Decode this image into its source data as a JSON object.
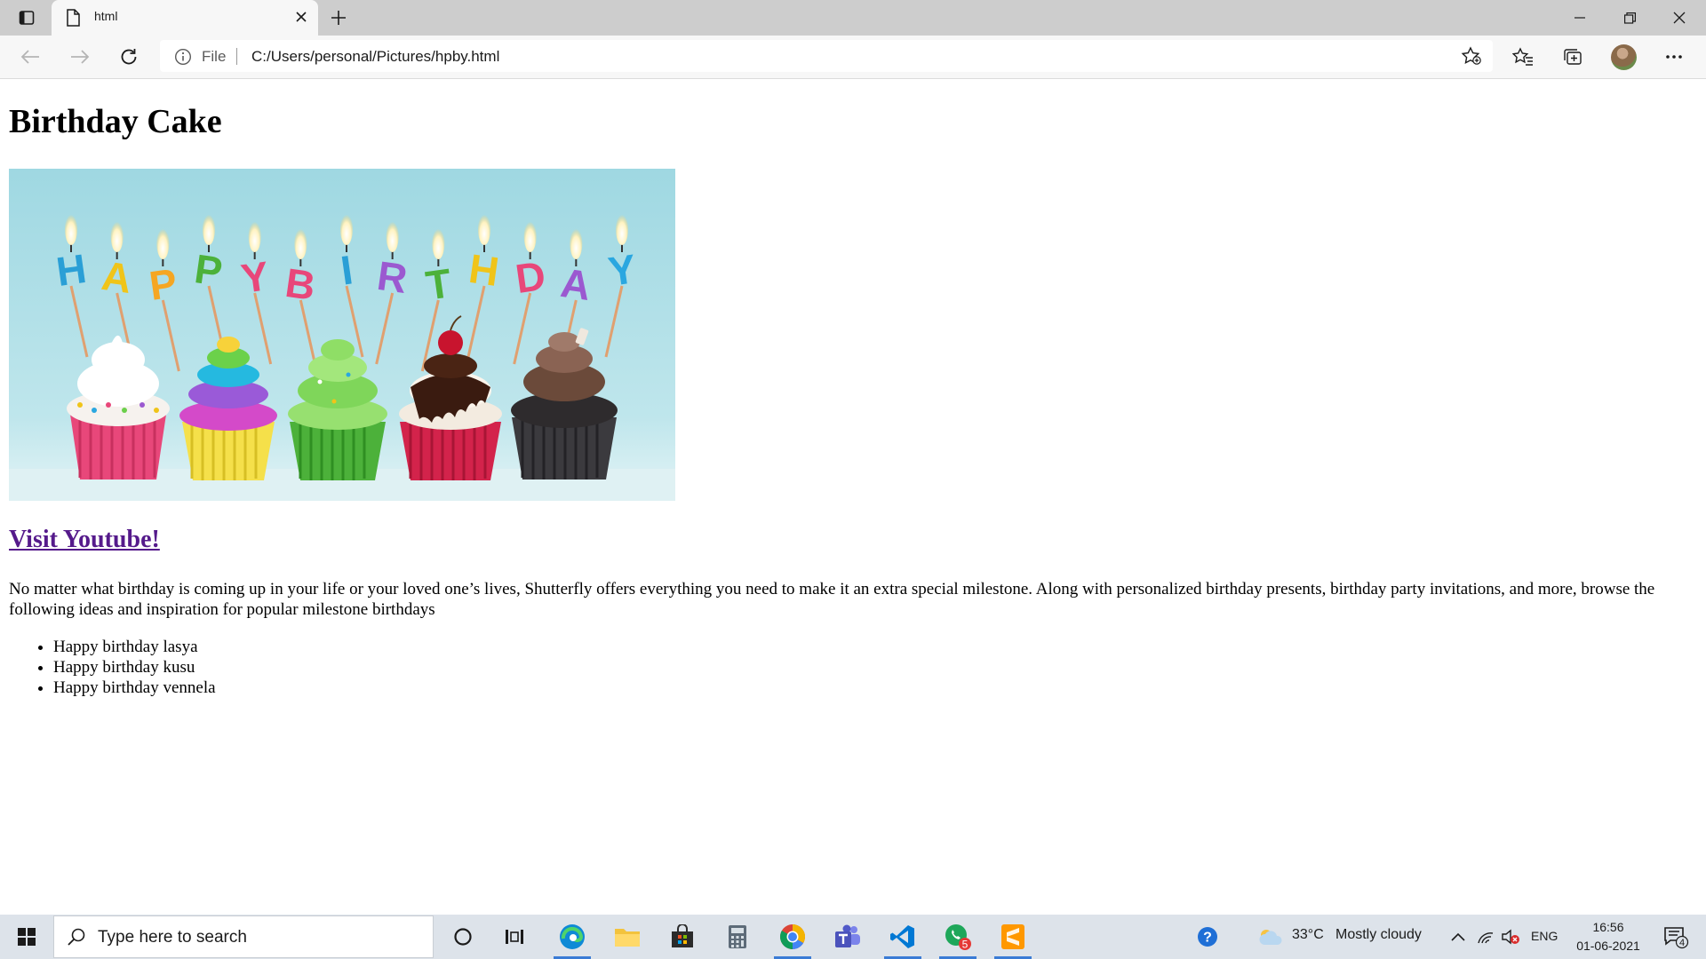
{
  "browser": {
    "tab": {
      "title": "html"
    },
    "address": {
      "scheme_label": "File",
      "url": "C:/Users/personal/Pictures/hpby.html"
    }
  },
  "page": {
    "heading": "Birthday Cake",
    "image": {
      "alt": "Happy birthday cupcakes",
      "candle_letters": [
        "H",
        "A",
        "P",
        "P",
        "Y",
        "B",
        "I",
        "R",
        "T",
        "H",
        "D",
        "A",
        "Y"
      ]
    },
    "link_text": "Visit Youtube!",
    "paragraph": "No matter what birthday is coming up in your life or your loved one’s lives, Shutterfly offers everything you need to make it an extra special milestone. Along with personalized birthday presents, birthday party invitations, and more, browse the following ideas and inspiration for popular milestone birthdays",
    "list": [
      "Happy birthday lasya",
      "Happy birthday kusu",
      "Happy birthday vennela"
    ]
  },
  "taskbar": {
    "search_placeholder": "Type here to search",
    "weather": {
      "temp": "33°C",
      "condition": "Mostly cloudy"
    },
    "language": "ENG",
    "time": "16:56",
    "date": "01-06-2021",
    "notification_count": "4",
    "badge_count": "5"
  },
  "colors": {
    "link_visited": "#551a8b",
    "tabstrip": "#cdcdcd",
    "toolbar": "#f7f7f7",
    "taskbar": "#dde3ea",
    "image_sky": "#a9dde6"
  }
}
